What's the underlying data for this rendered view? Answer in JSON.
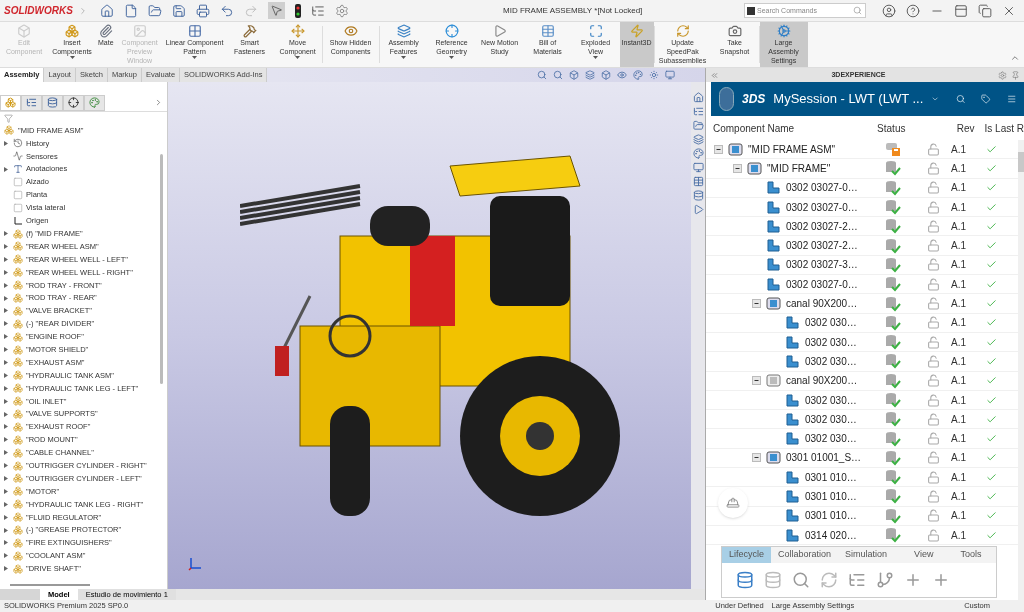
{
  "app": {
    "logo": "SOLIDWORKS",
    "title": "MID FRAME ASSEMBLY *[Not Locked]",
    "search": {
      "placeholder": "Search Commands"
    }
  },
  "ribbon": [
    {
      "label": "Edit Component",
      "disabled": true,
      "selected": false,
      "dropdown": false
    },
    {
      "label": "Insert Components",
      "disabled": false,
      "selected": false,
      "dropdown": true
    },
    {
      "label": "Mate",
      "disabled": false,
      "selected": false,
      "dropdown": false
    },
    {
      "label": "Component Preview Window",
      "disabled": true,
      "selected": false,
      "dropdown": false
    },
    {
      "label": "Linear Component Pattern",
      "disabled": false,
      "selected": false,
      "dropdown": true
    },
    {
      "label": "Smart Fasteners",
      "disabled": false,
      "selected": false,
      "dropdown": false
    },
    {
      "label": "Move Component",
      "disabled": false,
      "selected": false,
      "dropdown": true
    },
    {
      "label": "Show Hidden Components",
      "disabled": false,
      "selected": false,
      "dropdown": false
    },
    {
      "label": "Assembly Features",
      "disabled": false,
      "selected": false,
      "dropdown": true
    },
    {
      "label": "Reference Geometry",
      "disabled": false,
      "selected": false,
      "dropdown": true
    },
    {
      "label": "New Motion Study",
      "disabled": false,
      "selected": false,
      "dropdown": false
    },
    {
      "label": "Bill of Materials",
      "disabled": false,
      "selected": false,
      "dropdown": false
    },
    {
      "label": "Exploded View",
      "disabled": false,
      "selected": false,
      "dropdown": true
    },
    {
      "label": "Instant3D",
      "disabled": false,
      "selected": true,
      "dropdown": false
    },
    {
      "label": "Update SpeedPak Subassemblies",
      "disabled": false,
      "selected": false,
      "dropdown": false
    },
    {
      "label": "Take Snapshot",
      "disabled": false,
      "selected": false,
      "dropdown": false
    },
    {
      "label": "Large Assembly Settings",
      "disabled": false,
      "selected": true,
      "dropdown": false
    }
  ],
  "command_tabs": [
    {
      "label": "Assembly",
      "selected": true
    },
    {
      "label": "Layout",
      "selected": false
    },
    {
      "label": "Sketch",
      "selected": false
    },
    {
      "label": "Markup",
      "selected": false
    },
    {
      "label": "Evaluate",
      "selected": false
    },
    {
      "label": "SOLIDWORKS Add-Ins",
      "selected": false
    }
  ],
  "feature_tree": {
    "root": "\"MID FRAME ASM\"",
    "items": [
      {
        "kind": "history",
        "label": "History",
        "expandable": true
      },
      {
        "kind": "sensors",
        "label": "Sensores",
        "expandable": false
      },
      {
        "kind": "annotations",
        "label": "Anotaciones",
        "expandable": true
      },
      {
        "kind": "plane",
        "label": "Alzado",
        "expandable": false
      },
      {
        "kind": "plane",
        "label": "Planta",
        "expandable": false
      },
      {
        "kind": "plane",
        "label": "Vista lateral",
        "expandable": false
      },
      {
        "kind": "origin",
        "label": "Origen",
        "expandable": false
      },
      {
        "kind": "component",
        "label": "(f) \"MID FRAME\"",
        "expandable": true
      },
      {
        "kind": "component",
        "label": "\"REAR WHEEL ASM\"",
        "expandable": true
      },
      {
        "kind": "component",
        "label": "\"REAR WHEEL WELL - LEFT\"",
        "expandable": true
      },
      {
        "kind": "component",
        "label": "\"REAR WHEEL WELL - RIGHT\"",
        "expandable": true
      },
      {
        "kind": "component",
        "label": "\"ROD TRAY - FRONT\"",
        "expandable": true
      },
      {
        "kind": "component",
        "label": "\"ROD TRAY - REAR\"",
        "expandable": true
      },
      {
        "kind": "component",
        "label": "\"VALVE BRACKET\"",
        "expandable": true
      },
      {
        "kind": "component",
        "label": "(-) \"REAR DIVIDER\"",
        "expandable": true
      },
      {
        "kind": "component",
        "label": "\"ENGINE ROOF\"",
        "expandable": true
      },
      {
        "kind": "component",
        "label": "\"MOTOR SHIELD\"",
        "expandable": true
      },
      {
        "kind": "component",
        "label": "\"EXHAUST ASM\"",
        "expandable": true
      },
      {
        "kind": "component",
        "label": "\"HYDRAULIC TANK ASM\"",
        "expandable": true
      },
      {
        "kind": "component",
        "label": "\"HYDRAULIC TANK LEG - LEFT\"",
        "expandable": true
      },
      {
        "kind": "component",
        "label": "\"OIL INLET\"",
        "expandable": true
      },
      {
        "kind": "component",
        "label": "\"VALVE SUPPORTS\"",
        "expandable": true
      },
      {
        "kind": "component",
        "label": "\"EXHAUST ROOF\"",
        "expandable": true
      },
      {
        "kind": "component",
        "label": "\"ROD MOUNT\"",
        "expandable": true
      },
      {
        "kind": "component",
        "label": "\"CABLE CHANNEL\"",
        "expandable": true
      },
      {
        "kind": "component",
        "label": "\"OUTRIGGER CYLINDER - RIGHT\"",
        "expandable": true
      },
      {
        "kind": "component",
        "label": "\"OUTRIGGER CYLINDER - LEFT\"",
        "expandable": true
      },
      {
        "kind": "component",
        "label": "\"MOTOR\"",
        "expandable": true
      },
      {
        "kind": "component",
        "label": "\"HYDRAULIC TANK LEG - RIGHT\"",
        "expandable": true
      },
      {
        "kind": "component",
        "label": "\"FLUID REGULATOR\"",
        "expandable": true
      },
      {
        "kind": "component",
        "label": "(-) \"GREASE PROTECTOR\"",
        "expandable": true
      },
      {
        "kind": "component",
        "label": "\"FIRE EXTINGUISHERS\"",
        "expandable": true
      },
      {
        "kind": "component",
        "label": "\"COOLANT ASM\"",
        "expandable": true
      },
      {
        "kind": "component",
        "label": "\"DRIVE SHAFT\"",
        "expandable": true
      }
    ]
  },
  "model_tabs": [
    {
      "label": "Model",
      "selected": true
    },
    {
      "label": "Estudio de movimiento 1",
      "selected": false
    }
  ],
  "experience_panel": {
    "title": "3DEXPERIENCE",
    "brand": "3DS",
    "session": "MySession - LWT (LWT ...",
    "columns": [
      "Component Name",
      "Status",
      "Rev",
      "Is Last R"
    ],
    "rows": [
      {
        "kind": "assembly",
        "name": "\"MID FRAME ASM\"",
        "saved_locally": true,
        "locked": false,
        "rev": "A.1",
        "is_last": true,
        "expanded": true,
        "children": [
          {
            "kind": "assembly",
            "name": "\"MID FRAME\"",
            "saved_locally": false,
            "locked": false,
            "rev": "A.1",
            "is_last": true,
            "expanded": true,
            "children": [
              {
                "kind": "part",
                "name": "0302 03027-0…",
                "saved_locally": false,
                "locked": false,
                "rev": "A.1",
                "is_last": true
              },
              {
                "kind": "part",
                "name": "0302 03027-0…",
                "saved_locally": false,
                "locked": false,
                "rev": "A.1",
                "is_last": true
              },
              {
                "kind": "part",
                "name": "0302 03027-2…",
                "saved_locally": false,
                "locked": false,
                "rev": "A.1",
                "is_last": true
              },
              {
                "kind": "part",
                "name": "0302 03027-2…",
                "saved_locally": false,
                "locked": false,
                "rev": "A.1",
                "is_last": true
              },
              {
                "kind": "part",
                "name": "0302 03027-3…",
                "saved_locally": false,
                "locked": false,
                "rev": "A.1",
                "is_last": true
              },
              {
                "kind": "part",
                "name": "0302 03027-0…",
                "saved_locally": false,
                "locked": false,
                "rev": "A.1",
                "is_last": true
              },
              {
                "kind": "assembly",
                "name": "canal 90X200…",
                "saved_locally": false,
                "locked": false,
                "rev": "A.1",
                "is_last": true,
                "expanded": true,
                "children": [
                  {
                    "kind": "part",
                    "name": "0302 030…",
                    "saved_locally": false,
                    "locked": false,
                    "rev": "A.1",
                    "is_last": true
                  },
                  {
                    "kind": "part",
                    "name": "0302 030…",
                    "saved_locally": false,
                    "locked": false,
                    "rev": "A.1",
                    "is_last": true
                  },
                  {
                    "kind": "part",
                    "name": "0302 030…",
                    "saved_locally": false,
                    "locked": false,
                    "rev": "A.1",
                    "is_last": true
                  }
                ]
              },
              {
                "kind": "mirror",
                "name": "canal 90X200…",
                "saved_locally": false,
                "locked": false,
                "rev": "A.1",
                "is_last": true,
                "expanded": true,
                "children": [
                  {
                    "kind": "part",
                    "name": "0302 030…",
                    "saved_locally": false,
                    "locked": false,
                    "rev": "A.1",
                    "is_last": true
                  },
                  {
                    "kind": "part",
                    "name": "0302 030…",
                    "saved_locally": false,
                    "locked": false,
                    "rev": "A.1",
                    "is_last": true
                  },
                  {
                    "kind": "part",
                    "name": "0302 030…",
                    "saved_locally": false,
                    "locked": false,
                    "rev": "A.1",
                    "is_last": true
                  }
                ]
              },
              {
                "kind": "assembly",
                "name": "0301 01001_S…",
                "saved_locally": false,
                "locked": false,
                "rev": "A.1",
                "is_last": true,
                "expanded": true,
                "children": [
                  {
                    "kind": "part",
                    "name": "0301 010…",
                    "saved_locally": false,
                    "locked": false,
                    "rev": "A.1",
                    "is_last": true
                  },
                  {
                    "kind": "part",
                    "name": "0301 010…",
                    "saved_locally": false,
                    "locked": false,
                    "rev": "A.1",
                    "is_last": true
                  },
                  {
                    "kind": "part",
                    "name": "0301 010…",
                    "saved_locally": false,
                    "locked": false,
                    "rev": "A.1",
                    "is_last": true
                  },
                  {
                    "kind": "part",
                    "name": "0314 020…",
                    "saved_locally": false,
                    "locked": false,
                    "rev": "A.1",
                    "is_last": true
                  }
                ]
              }
            ]
          }
        ]
      }
    ],
    "action_tabs": [
      {
        "label": "Lifecycle",
        "selected": true
      },
      {
        "label": "Collaboration",
        "selected": false
      },
      {
        "label": "Simulation",
        "selected": false
      },
      {
        "label": "View",
        "selected": false
      },
      {
        "label": "Tools",
        "selected": false
      }
    ]
  },
  "status_bar": {
    "product": "SOLIDWORKS Premium 2025 SP0.0",
    "state": "Under Defined",
    "mode": "Large Assembly Settings",
    "units": "Custom"
  }
}
